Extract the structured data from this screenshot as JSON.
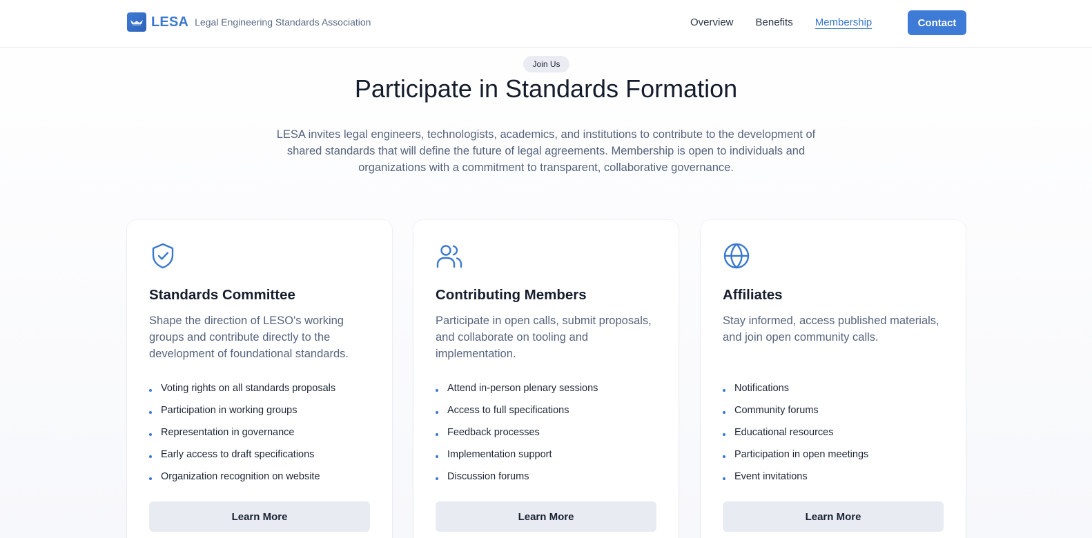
{
  "header": {
    "brand_abbr": "LESA",
    "brand_full": "Legal Engineering Standards Association",
    "nav": [
      {
        "label": "Overview",
        "active": false
      },
      {
        "label": "Benefits",
        "active": false
      },
      {
        "label": "Membership",
        "active": true
      }
    ],
    "contact_label": "Contact"
  },
  "hero": {
    "badge": "Join Us",
    "title": "Participate in Standards Formation",
    "intro": "LESA invites legal engineers, technologists, academics, and institutions to contribute to the development of shared standards that will define the future of legal agreements. Membership is open to individuals and organizations with a commitment to transparent, collaborative governance."
  },
  "cards": [
    {
      "icon": "shield-check-icon",
      "title": "Standards Committee",
      "description": "Shape the direction of LESO's working groups and contribute directly to the development of foundational standards.",
      "features": [
        "Voting rights on all standards proposals",
        "Participation in working groups",
        "Representation in governance",
        "Early access to draft specifications",
        "Organization recognition on website"
      ],
      "button": "Learn More"
    },
    {
      "icon": "users-icon",
      "title": "Contributing Members",
      "description": "Participate in open calls, submit proposals, and collaborate on tooling and implementation.",
      "features": [
        "Attend in-person plenary sessions",
        "Access to full specifications",
        "Feedback processes",
        "Implementation support",
        "Discussion forums"
      ],
      "button": "Learn More"
    },
    {
      "icon": "globe-icon",
      "title": "Affiliates",
      "description": "Stay informed, access published materials, and join open community calls.",
      "features": [
        "Notifications",
        "Community forums",
        "Educational resources",
        "Participation in open meetings",
        "Event invitations"
      ],
      "button": "Learn More"
    }
  ],
  "colors": {
    "accent": "#3a78cf",
    "button_bg": "#e8ebf1",
    "text_muted": "#56647c"
  }
}
